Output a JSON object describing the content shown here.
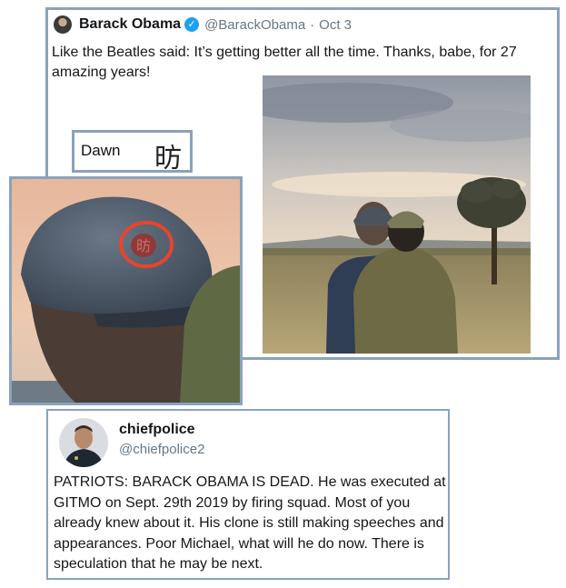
{
  "tweet1": {
    "name": "Barack Obama",
    "verified": "✓",
    "handle": "@BarackObama",
    "separator": "·",
    "date": "Oct 3",
    "text": "Like the Beatles said: It’s getting better all the time. Thanks, babe, for 27 amazing years!"
  },
  "label": {
    "word": "Dawn",
    "character": "昉"
  },
  "cap_emblem": {
    "character": "昉"
  },
  "tweet2": {
    "name": "chiefpolice",
    "handle": "@chiefpolice2",
    "text": "PATRIOTS: BARACK OBAMA IS DEAD. He was executed at GITMO on Sept. 29th 2019 by firing squad. Most of you already knew about it. His clone is still making speeches and appearances. Poor Michael, what will he do now. There is speculation that he may be next."
  },
  "colors": {
    "panel_border": "#8aa2bd",
    "verified_blue": "#1da1f2",
    "handle_gray": "#657786",
    "circle_highlight": "#e8452c"
  }
}
